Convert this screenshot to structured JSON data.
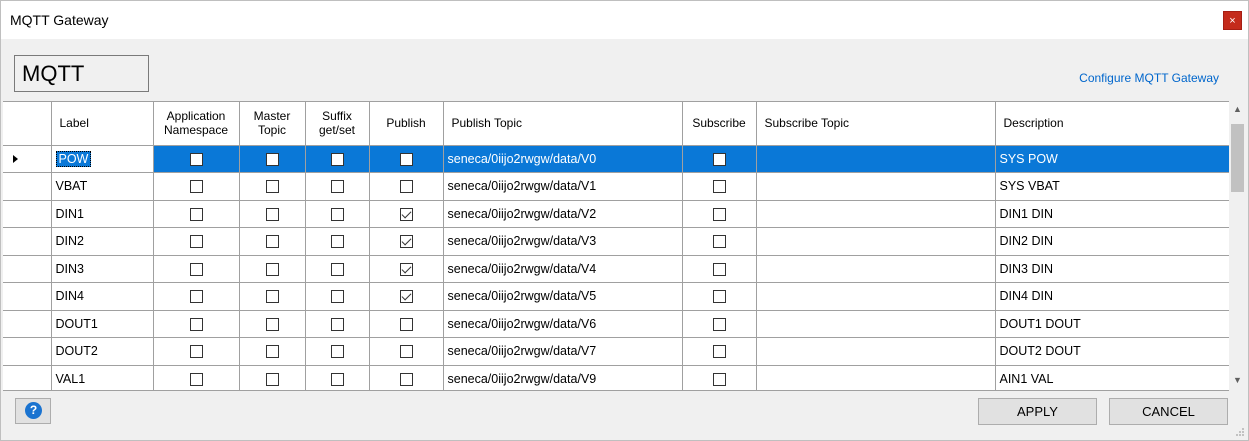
{
  "window": {
    "title": "MQTT Gateway",
    "close_symbol": "×"
  },
  "header": {
    "section_label": "MQTT",
    "configure_link": "Configure MQTT Gateway"
  },
  "grid": {
    "columns": [
      "Label",
      "Application Namespace",
      "Master Topic",
      "Suffix get/set",
      "Publish",
      "Publish Topic",
      "Subscribe",
      "Subscribe Topic",
      "Description"
    ],
    "rows": [
      {
        "label": "POW",
        "app_ns": false,
        "master": false,
        "suffix": false,
        "publish": false,
        "publish_topic": "seneca/0iijo2rwgw/data/V0",
        "subscribe": false,
        "subscribe_topic": "",
        "description": "SYS POW"
      },
      {
        "label": "VBAT",
        "app_ns": false,
        "master": false,
        "suffix": false,
        "publish": false,
        "publish_topic": "seneca/0iijo2rwgw/data/V1",
        "subscribe": false,
        "subscribe_topic": "",
        "description": "SYS VBAT"
      },
      {
        "label": "DIN1",
        "app_ns": false,
        "master": false,
        "suffix": false,
        "publish": true,
        "publish_topic": "seneca/0iijo2rwgw/data/V2",
        "subscribe": false,
        "subscribe_topic": "",
        "description": "DIN1 DIN"
      },
      {
        "label": "DIN2",
        "app_ns": false,
        "master": false,
        "suffix": false,
        "publish": true,
        "publish_topic": "seneca/0iijo2rwgw/data/V3",
        "subscribe": false,
        "subscribe_topic": "",
        "description": "DIN2 DIN"
      },
      {
        "label": "DIN3",
        "app_ns": false,
        "master": false,
        "suffix": false,
        "publish": true,
        "publish_topic": "seneca/0iijo2rwgw/data/V4",
        "subscribe": false,
        "subscribe_topic": "",
        "description": "DIN3 DIN"
      },
      {
        "label": "DIN4",
        "app_ns": false,
        "master": false,
        "suffix": false,
        "publish": true,
        "publish_topic": "seneca/0iijo2rwgw/data/V5",
        "subscribe": false,
        "subscribe_topic": "",
        "description": "DIN4 DIN"
      },
      {
        "label": "DOUT1",
        "app_ns": false,
        "master": false,
        "suffix": false,
        "publish": false,
        "publish_topic": "seneca/0iijo2rwgw/data/V6",
        "subscribe": false,
        "subscribe_topic": "",
        "description": "DOUT1 DOUT"
      },
      {
        "label": "DOUT2",
        "app_ns": false,
        "master": false,
        "suffix": false,
        "publish": false,
        "publish_topic": "seneca/0iijo2rwgw/data/V7",
        "subscribe": false,
        "subscribe_topic": "",
        "description": "DOUT2 DOUT"
      },
      {
        "label": "VAL1",
        "app_ns": false,
        "master": false,
        "suffix": false,
        "publish": false,
        "publish_topic": "seneca/0iijo2rwgw/data/V9",
        "subscribe": false,
        "subscribe_topic": "",
        "description": "AIN1 VAL"
      }
    ],
    "selected_row": 0
  },
  "footer": {
    "help_icon": "question-icon",
    "help_symbol": "?",
    "apply_label": "APPLY",
    "cancel_label": "CANCEL"
  },
  "colors": {
    "selection": "#0a78d7",
    "link": "#0066cc",
    "close": "#c42b1c",
    "help": "#1a73d0"
  }
}
